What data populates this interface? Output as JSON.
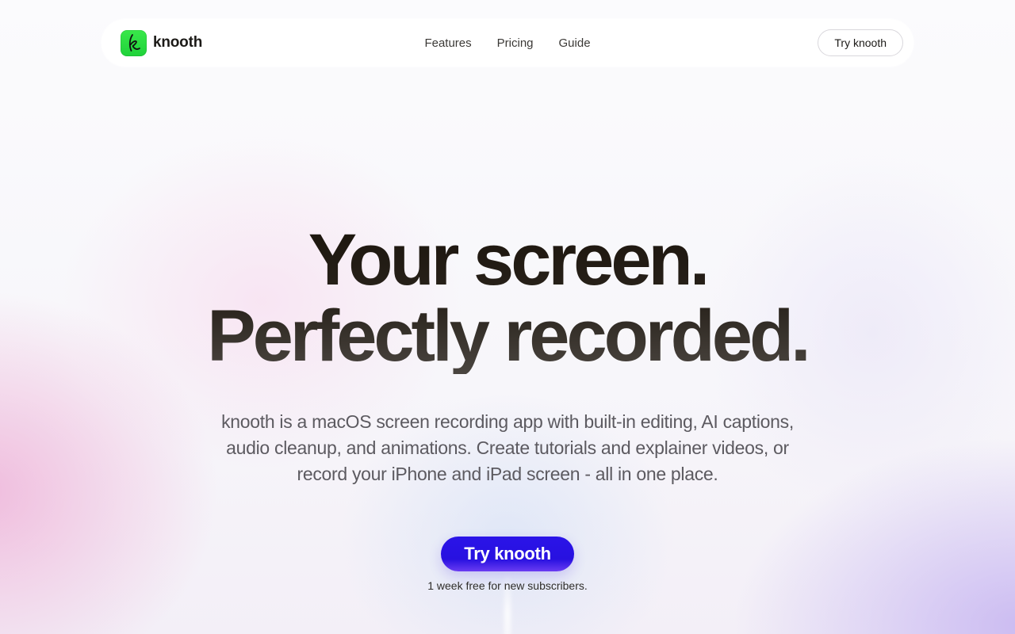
{
  "nav": {
    "brand": "knooth",
    "logo_icon": "k-script-logo-icon",
    "links": [
      "Features",
      "Pricing",
      "Guide"
    ],
    "cta_label": "Try knooth"
  },
  "hero": {
    "headline_line1": "Your screen.",
    "headline_line2": "Perfectly recorded.",
    "subtitle": "knooth is a macOS screen recording app with built-in editing, AI captions, audio cleanup, and animations. Create tutorials and explainer videos, or record your iPhone and iPad screen - all in one place.",
    "cta_label": "Try knooth",
    "cta_note": "1 week free for new subscribers."
  },
  "colors": {
    "logo_green": "#2bdc40",
    "cta_blue": "#2811e0",
    "headline": "#1b140c",
    "subtitle": "#5c5a60"
  }
}
